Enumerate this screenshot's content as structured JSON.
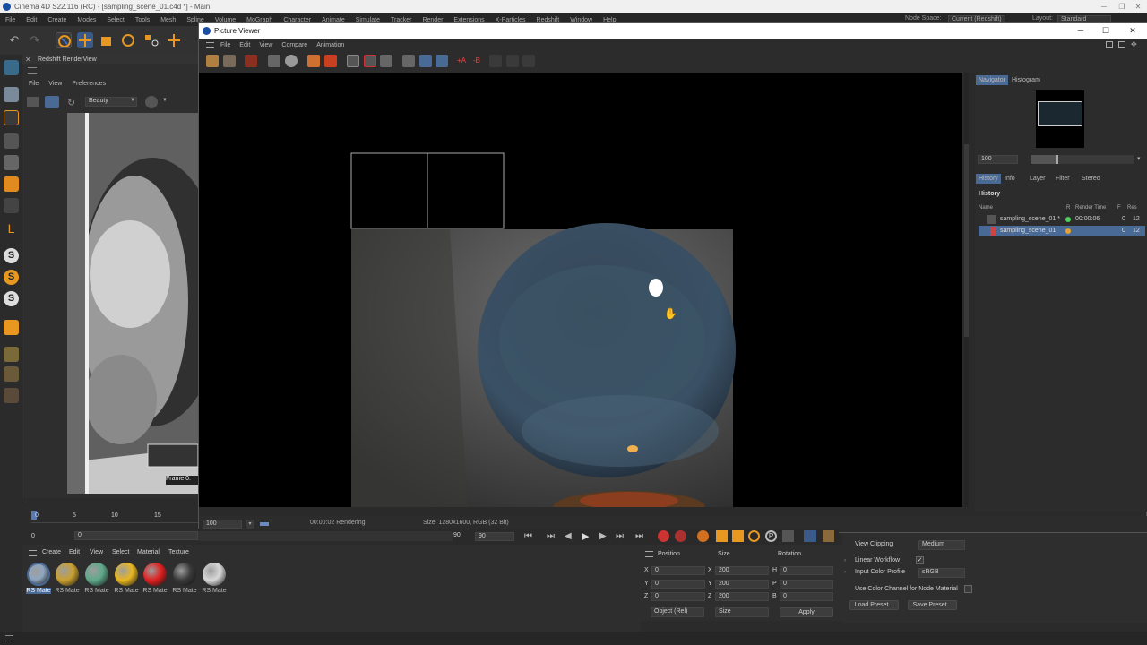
{
  "main_window": {
    "title": "Cinema 4D S22.116 (RC) - [sampling_scene_01.c4d *] - Main",
    "menu": [
      "File",
      "Edit",
      "Create",
      "Modes",
      "Select",
      "Tools",
      "Mesh",
      "Spline",
      "Volume",
      "MoGraph",
      "Character",
      "Animate",
      "Simulate",
      "Tracker",
      "Render",
      "Extensions",
      "X-Particles",
      "Redshift",
      "Window",
      "Help"
    ],
    "node_space_label": "Node Space:",
    "node_space_value": "Current (Redshift)",
    "layout_label": "Layout:",
    "layout_value": "Standard"
  },
  "rs_panel": {
    "title": "Redshift RenderView",
    "menu": [
      "File",
      "View",
      "Preferences"
    ],
    "aov_value": "Beauty",
    "frame_label": "Frame 0:"
  },
  "picture_viewer": {
    "title": "Picture Viewer",
    "menu": [
      "File",
      "Edit",
      "View",
      "Compare",
      "Animation"
    ],
    "zoom_value": "100",
    "status_time": "00:00:02 Rendering",
    "status_size": "Size: 1280x1600, RGB (32 Bit)",
    "nav_tabs": [
      "Navigator",
      "Histogram"
    ],
    "nav_zoom": "100",
    "history_tabs": [
      "History",
      "Info",
      "Layer",
      "Filter",
      "Stereo"
    ],
    "history_heading": "History",
    "history_columns": [
      "Name",
      "R",
      "Render Time",
      "F",
      "Res"
    ],
    "history_rows": [
      {
        "name": "sampling_scene_01 *",
        "time": "00:00:06",
        "f": "0",
        "res": "12",
        "status_color": "#4ccf5a"
      },
      {
        "name": "sampling_scene_01",
        "time": "",
        "f": "0",
        "res": "12",
        "status_color": "#e8a030"
      }
    ]
  },
  "timeline": {
    "ticks": [
      "0",
      "5",
      "10",
      "15"
    ],
    "start_field": "0",
    "start_field2": "0",
    "end_field": "90",
    "end_field2": "90"
  },
  "materials": {
    "menu": [
      "Create",
      "Edit",
      "View",
      "Select",
      "Material",
      "Texture"
    ],
    "items": [
      {
        "label": "RS Mate",
        "color": "#8fa6bf"
      },
      {
        "label": "RS Mate",
        "color": "#c9a030"
      },
      {
        "label": "RS Mate",
        "color": "#5fa88a"
      },
      {
        "label": "RS Mate",
        "color": "#e8b620"
      },
      {
        "label": "RS Mate",
        "color": "#e02020"
      },
      {
        "label": "RS Mate",
        "color": "#3a3a3a"
      },
      {
        "label": "RS Mate",
        "color": "#d8d8d8"
      }
    ]
  },
  "coords": {
    "headers": [
      "Position",
      "Size",
      "Rotation"
    ],
    "rows": [
      {
        "axis": "X",
        "pos": "0",
        "size_axis": "X",
        "size": "200",
        "rot_axis": "H",
        "rot": "0"
      },
      {
        "axis": "Y",
        "pos": "0",
        "size_axis": "Y",
        "size": "200",
        "rot_axis": "P",
        "rot": "0"
      },
      {
        "axis": "Z",
        "pos": "0",
        "size_axis": "Z",
        "size": "200",
        "rot_axis": "B",
        "rot": "0"
      }
    ],
    "mode_value": "Object (Rel)",
    "size_mode_value": "Size",
    "apply_label": "Apply"
  },
  "attributes": {
    "view_clipping_label": "View Clipping",
    "view_clipping_value": "Medium",
    "linear_workflow_label": "Linear Workflow",
    "input_color_profile_label": "Input Color Profile",
    "input_color_profile_value": "sRGB",
    "use_color_channel_label": "Use Color Channel for Node Material",
    "load_preset_label": "Load Preset...",
    "save_preset_label": "Save Preset..."
  }
}
